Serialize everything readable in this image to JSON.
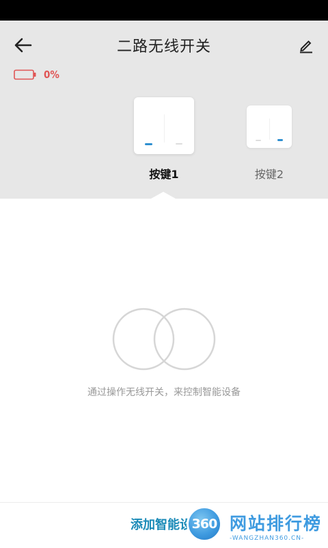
{
  "header": {
    "title": "二路无线开关",
    "back_icon": "arrow-left-icon",
    "edit_icon": "pencil-icon"
  },
  "battery": {
    "level_text": "0%",
    "level": 0,
    "color": "#e05555"
  },
  "keys": [
    {
      "label": "按键1",
      "selected": true
    },
    {
      "label": "按键2",
      "selected": false
    }
  ],
  "empty_state": {
    "message": "通过操作无线开关，来控制智能设备"
  },
  "bottom": {
    "add_device_label": "添加智能设备",
    "accent": "#1a8ab7"
  },
  "watermark": {
    "logo_text": "360",
    "title": "网站排行榜",
    "subtitle": "-WANGZHAN360.CN-"
  }
}
